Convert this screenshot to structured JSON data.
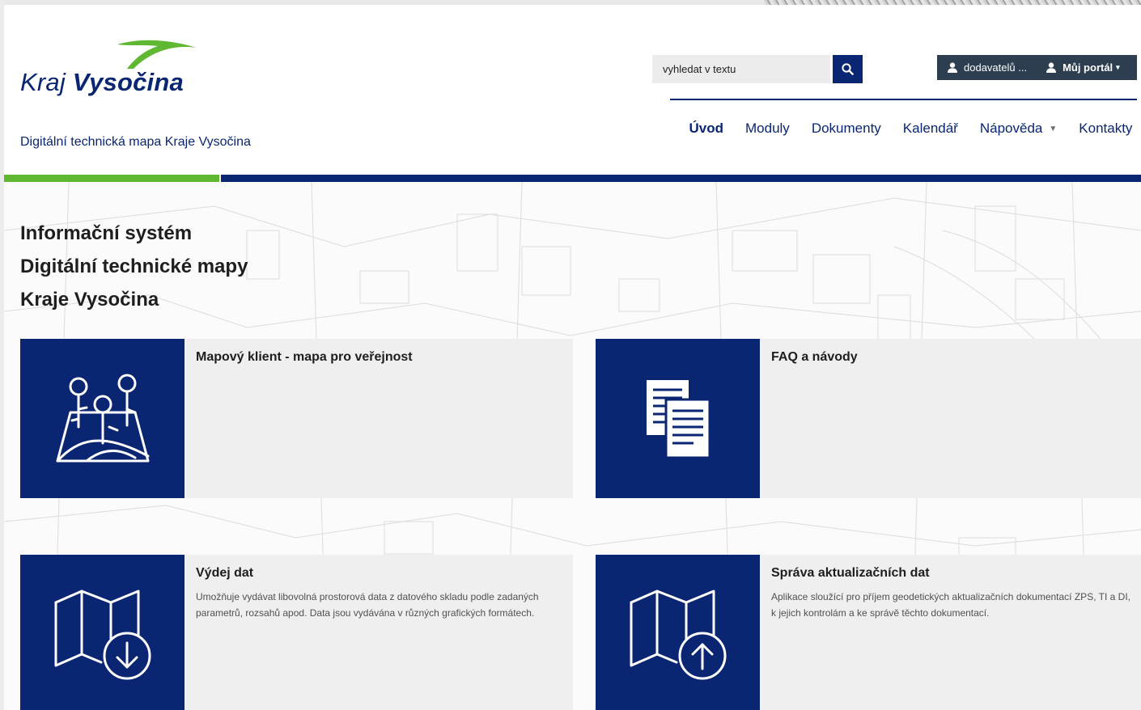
{
  "brand": {
    "logo_text_1": "Kraj",
    "logo_text_2": "Vysočina",
    "subtitle": "Digitální technická mapa Kraje Vysočina",
    "colors": {
      "navy": "#0a2672",
      "green": "#5fb832",
      "dark": "#2d3e50"
    }
  },
  "search": {
    "placeholder": "vyhledat v textu",
    "button_icon": "search-icon"
  },
  "userbar": {
    "user_label": "dodavatelů ...",
    "portal_label": "Můj portál"
  },
  "nav": {
    "items": [
      {
        "label": "Úvod",
        "active": true
      },
      {
        "label": "Moduly"
      },
      {
        "label": "Dokumenty"
      },
      {
        "label": "Kalendář"
      },
      {
        "label": "Nápověda",
        "dropdown": true
      },
      {
        "label": "Kontakty"
      }
    ]
  },
  "intro": {
    "line1": "Informační systém",
    "line2": "Digitální technické mapy",
    "line3": "Kraje Vysočina"
  },
  "tiles": [
    {
      "title": "Mapový klient - mapa pro veřejnost",
      "description": "",
      "icon": "map-pins-icon"
    },
    {
      "title": "FAQ a návody",
      "description": "",
      "icon": "documents-icon"
    },
    {
      "title": "Výdej dat",
      "description": "Umožňuje vydávat libovolná prostorová data z datového skladu podle zadaných parametrů, rozsahů apod. Data jsou vydávána v různých grafických formátech.",
      "icon": "map-download-icon"
    },
    {
      "title": "Správa aktualizačních dat",
      "description": "Aplikace sloužící pro příjem geodetických aktualizačních dokumentací ZPS, TI a DI, k jejich kontrolám a ke správě těchto dokumentací.",
      "icon": "map-upload-icon"
    }
  ]
}
